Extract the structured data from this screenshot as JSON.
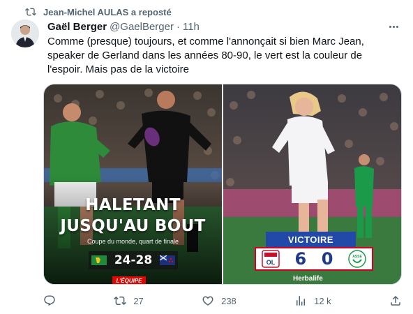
{
  "repost": {
    "text": "Jean-Michel AULAS a reposté",
    "icon": "repost-icon"
  },
  "tweet": {
    "author_name": "Gaël Berger",
    "handle": "@GaelBerger",
    "separator": "·",
    "time": "11h",
    "text_lines": [
      "Comme (presque) toujours, et comme l'annonçait si bien Marc Jean,",
      "speaker de Gerland dans les années 80-90, le vert est la couleur de",
      "l'espoir. Mais pas de la victoire"
    ]
  },
  "media": {
    "left": {
      "headline_1": "HALETANT",
      "headline_2": "JUSQU'AU BOUT",
      "subline": "Coupe du monde, quart de finale",
      "score": "24-28",
      "brand": "L'ÉQUIPE"
    },
    "right": {
      "banner": "VICTOIRE",
      "home_score": "6",
      "away_score": "0",
      "sponsor": "Herbalife",
      "away_badge_text": "ASSE"
    }
  },
  "actions": {
    "reply_icon": "reply-icon",
    "retweets": "27",
    "likes": "238",
    "views": "12 k"
  },
  "colors": {
    "secondary_text": "#536471",
    "border": "#cfd9de",
    "ireland_green": "#2e8b3a",
    "all_blacks": "#111111",
    "ol_blue": "#2349a8",
    "asse_green": "#1b9a4a"
  }
}
